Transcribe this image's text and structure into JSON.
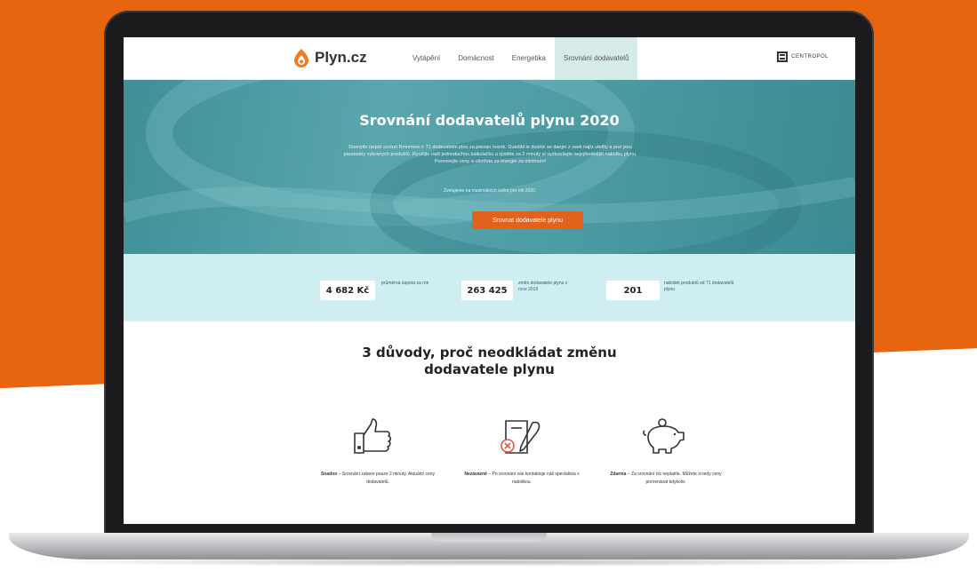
{
  "nav": {
    "logo_text": "Plyn.cz",
    "items": [
      {
        "label": "Vytápění"
      },
      {
        "label": "Domácnost"
      },
      {
        "label": "Energetika"
      },
      {
        "label": "Srovnání dodavatelů"
      }
    ],
    "partner_text": "CENTROPOL"
  },
  "hero": {
    "title": "Srovnání dodavatelů plynu 2020",
    "description": "Dusnyilo rarpdr szvturi Rmnmore ir 71 dodavatelni plnu za presan rvsmk. Duarlibl ie dusrtic se danjm z vsek najtz uteltty a prei jsou paramatry vybranych produktů. Ryužijte naši jednoduchou kalkulačku a zjistěte za 2 minuty si vyzkoušejte nejvýhodnější nabídku plynu. Porovnejte ceny a ušetřete za energie za minimum!",
    "note": "Zvetujeme na maximálních úvěru pro rok 2020",
    "button_label": "Srovnat dodavatele plynu"
  },
  "stats": [
    {
      "value": "4 682 Kč",
      "label": "průměrná úspora za rok"
    },
    {
      "value": "263 425",
      "label": "změn dodavatele plynu v roce 2019"
    },
    {
      "value": "201",
      "label": "nabídek produktů od 71 dodavatelů plynu"
    }
  ],
  "reasons": {
    "title_line1": "3 důvody, proč neodkládat změnu",
    "title_line2": "dodavatele plynu",
    "items": [
      {
        "icon": "thumbs-up-icon",
        "bold": "Snadno",
        "text": " – Srovnání zabere pouze 2 minuty. Aktuální ceny dodavatelů."
      },
      {
        "icon": "contract-sign-icon",
        "bold": "Nezávazně",
        "text": " – Po srovnání vás kontaktuje náš specialista s nabídkou."
      },
      {
        "icon": "piggy-bank-icon",
        "bold": "Zdarma",
        "text": " – Za srovnání nic neplatíte. Můžete si tedy ceny porovnávat kdykoliv."
      }
    ]
  },
  "colors": {
    "brand_orange": "#e8650f",
    "button_orange": "#e0621c",
    "hero_teal": "#4d9ba3",
    "stats_bg": "#cfeef2"
  }
}
